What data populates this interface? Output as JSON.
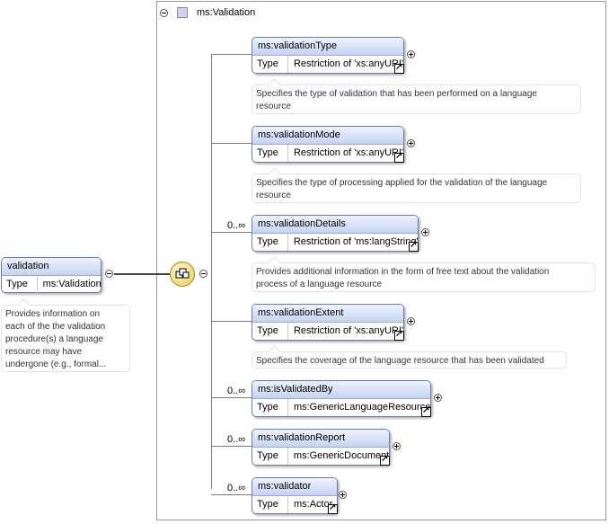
{
  "root": {
    "name": "validation",
    "type_label": "Type",
    "type_value": "ms:Validation",
    "annotation_lines": [
      "Provides information on",
      "each of the the validation",
      "procedure(s) a language",
      "resource may have",
      "undergone (e.g., formal..."
    ]
  },
  "group": {
    "title": "ms:Validation"
  },
  "children": [
    {
      "name": "ms:validationType",
      "type_label": "Type",
      "type_value": "Restriction of 'xs:anyURI'",
      "occurrence": "",
      "annotation_lines": [
        "Specifies the type of validation that has been performed on a language",
        "resource"
      ]
    },
    {
      "name": "ms:validationMode",
      "type_label": "Type",
      "type_value": "Restriction of 'xs:anyURI'",
      "occurrence": "",
      "annotation_lines": [
        "Specifies the type of processing applied for the validation of the language",
        "resource"
      ]
    },
    {
      "name": "ms:validationDetails",
      "type_label": "Type",
      "type_value": "Restriction of 'ms:langString'",
      "occurrence": "0..∞",
      "annotation_lines": [
        "Provides additional information in the form of free text about the validation",
        "process of a language resource"
      ]
    },
    {
      "name": "ms:validationExtent",
      "type_label": "Type",
      "type_value": "Restriction of 'xs:anyURI'",
      "occurrence": "",
      "annotation_lines": [
        "Specifies the coverage of the language resource that has been validated"
      ]
    },
    {
      "name": "ms:isValidatedBy",
      "type_label": "Type",
      "type_value": "ms:GenericLanguageResource",
      "occurrence": "0..∞",
      "annotation_lines": []
    },
    {
      "name": "ms:validationReport",
      "type_label": "Type",
      "type_value": "ms:GenericDocument",
      "occurrence": "0..∞",
      "annotation_lines": []
    },
    {
      "name": "ms:validator",
      "type_label": "Type",
      "type_value": "ms:Actor",
      "occurrence": "0..∞",
      "annotation_lines": []
    }
  ]
}
